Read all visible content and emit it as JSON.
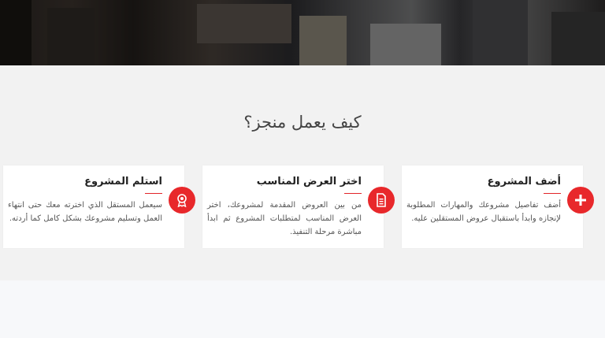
{
  "section": {
    "title": "كيف يعمل منجز؟",
    "steps": [
      {
        "title": "أضف المشروع",
        "description": "أضف تفاصيل مشروعك والمهارات المطلوبة لإنجازه وابدأ باستقبال عروض المستقلين عليه.",
        "icon": "plus-icon"
      },
      {
        "title": "اختر العرض المناسب",
        "description": "من بين العروض المقدمة لمشروعك، اختر العرض المناسب لمتطلبات المشروع ثم ابدأ مباشرة مرحلة التنفيذ.",
        "icon": "document-icon"
      },
      {
        "title": "استلم المشروع",
        "description": "سيعمل المستقل الذي اخترته معك حتى انتهاء العمل وتسليم مشروعك بشكل كامل كما أردته.",
        "icon": "award-icon"
      }
    ]
  },
  "colors": {
    "accent": "#e8282b",
    "section_bg": "#f2f2f2"
  }
}
